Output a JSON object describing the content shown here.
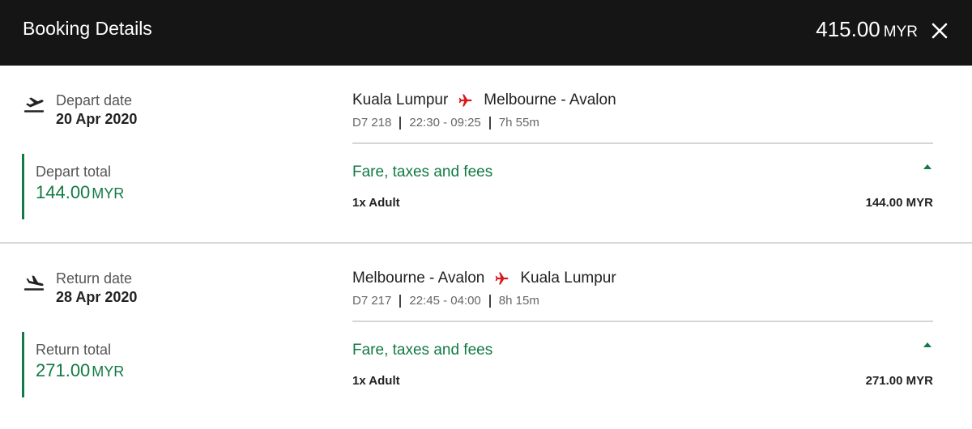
{
  "header": {
    "title": "Booking Details",
    "total_amount": "415.00",
    "total_currency": "MYR",
    "close_icon": "close-icon"
  },
  "colors": {
    "header_bg": "#151515",
    "accent_green": "#137a45",
    "plane_red": "#d71920"
  },
  "depart": {
    "date_label": "Depart date",
    "date_value": "20 Apr 2020",
    "total_label": "Depart total",
    "total_amount": "144.00",
    "total_currency": "MYR",
    "origin": "Kuala Lumpur",
    "destination": "Melbourne - Avalon",
    "flight_no": "D7 218",
    "times": "22:30 - 09:25",
    "duration": "7h 55m",
    "fare_label": "Fare, taxes and fees",
    "pax_label": "1x Adult",
    "pax_amount": "144.00 MYR"
  },
  "return": {
    "date_label": "Return date",
    "date_value": "28 Apr 2020",
    "total_label": "Return total",
    "total_amount": "271.00",
    "total_currency": "MYR",
    "origin": "Melbourne - Avalon",
    "destination": "Kuala Lumpur",
    "flight_no": "D7 217",
    "times": "22:45 - 04:00",
    "duration": "8h 15m",
    "fare_label": "Fare, taxes and fees",
    "pax_label": "1x Adult",
    "pax_amount": "271.00 MYR"
  }
}
